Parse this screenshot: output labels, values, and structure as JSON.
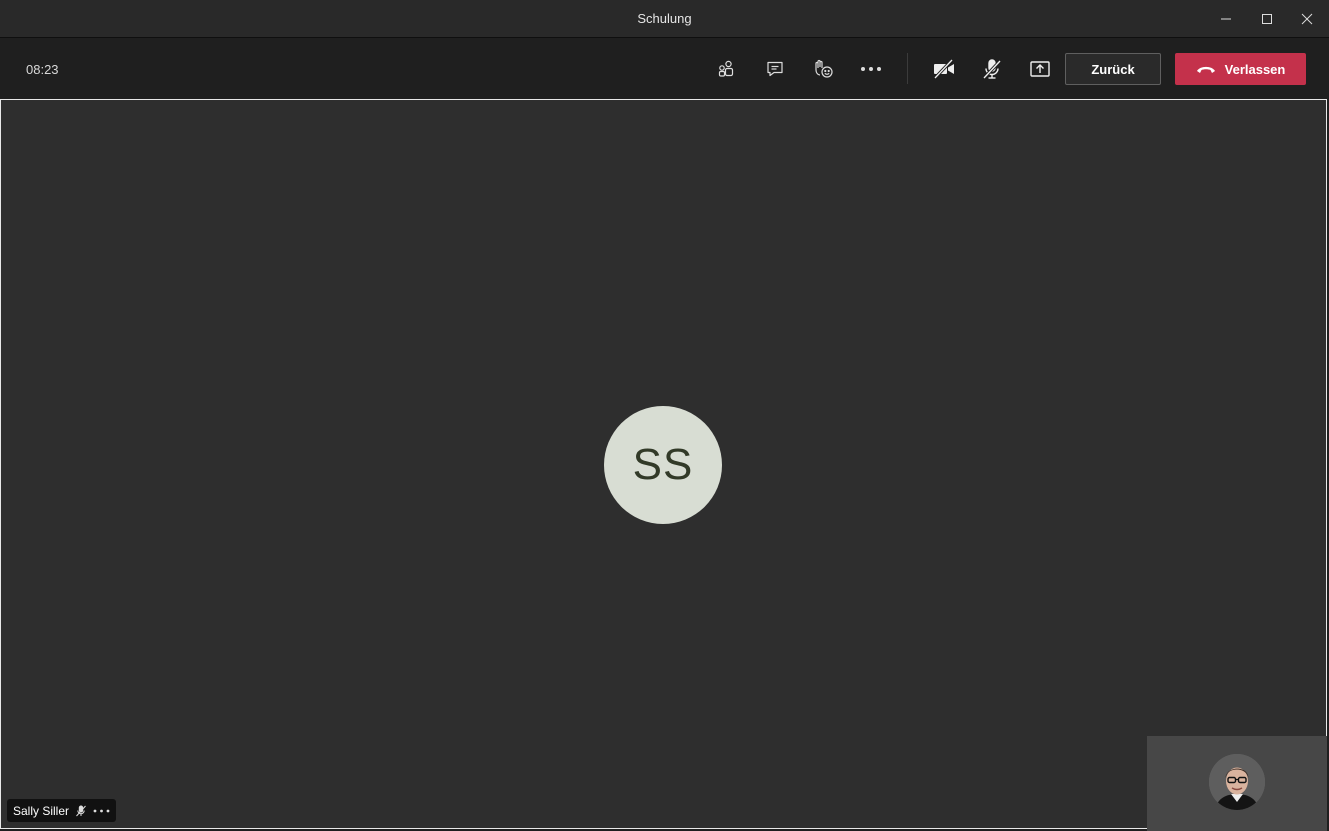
{
  "window": {
    "title": "Schulung"
  },
  "toolbar": {
    "timer": "08:23",
    "icons": {
      "participants": "participants-icon",
      "chat": "chat-icon",
      "reactions": "reactions-icon",
      "more": "more-options-icon",
      "camera": "camera-off-icon",
      "mic": "mic-off-icon",
      "share": "share-screen-icon"
    },
    "back_label": "Zurück",
    "leave_label": "Verlassen",
    "leave_color": "#c4314b"
  },
  "stage": {
    "avatar_initials": "SS",
    "avatar_color": "#d8ddd3",
    "participant_name": "Sally Siller"
  }
}
